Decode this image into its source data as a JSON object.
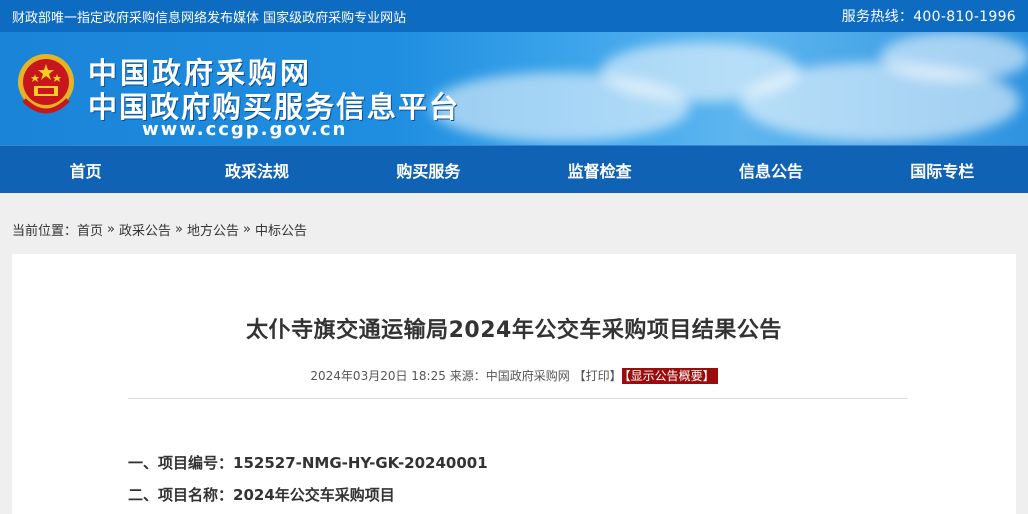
{
  "topbar": {
    "slogan": "财政部唯一指定政府采购信息网络发布媒体 国家级政府采购专业网站",
    "hotline": "服务热线：400-810-1996"
  },
  "header": {
    "title_line1": "中国政府采购网",
    "title_line2": "中国政府购买服务信息平台",
    "url": "www.ccgp.gov.cn",
    "logo_icon": "national-emblem-icon"
  },
  "nav": {
    "items": [
      {
        "label": "首页"
      },
      {
        "label": "政采法规"
      },
      {
        "label": "购买服务"
      },
      {
        "label": "监督检查"
      },
      {
        "label": "信息公告"
      },
      {
        "label": "国际专栏"
      }
    ]
  },
  "breadcrumb": {
    "prefix": "当前位置：",
    "items": [
      "首页",
      "政采公告",
      "地方公告",
      "中标公告"
    ],
    "separator": "»"
  },
  "notice": {
    "title": "太仆寺旗交通运输局2024年公交车采购项目结果公告",
    "date": "2024年03月20日 18:25",
    "source_label": "来源：",
    "source": "中国政府采购网",
    "print_label": "【打印】",
    "summary_label": "【显示公告概要】",
    "fields": [
      {
        "label": "一、项目编号：",
        "value": "152527-NMG-HY-GK-20240001"
      },
      {
        "label": "二、项目名称：",
        "value": "2024年公交车采购项目"
      }
    ]
  },
  "colors": {
    "topbar": "#0d6bc2",
    "nav": "#0f62b4",
    "summary_badge": "#9b0d0d"
  }
}
